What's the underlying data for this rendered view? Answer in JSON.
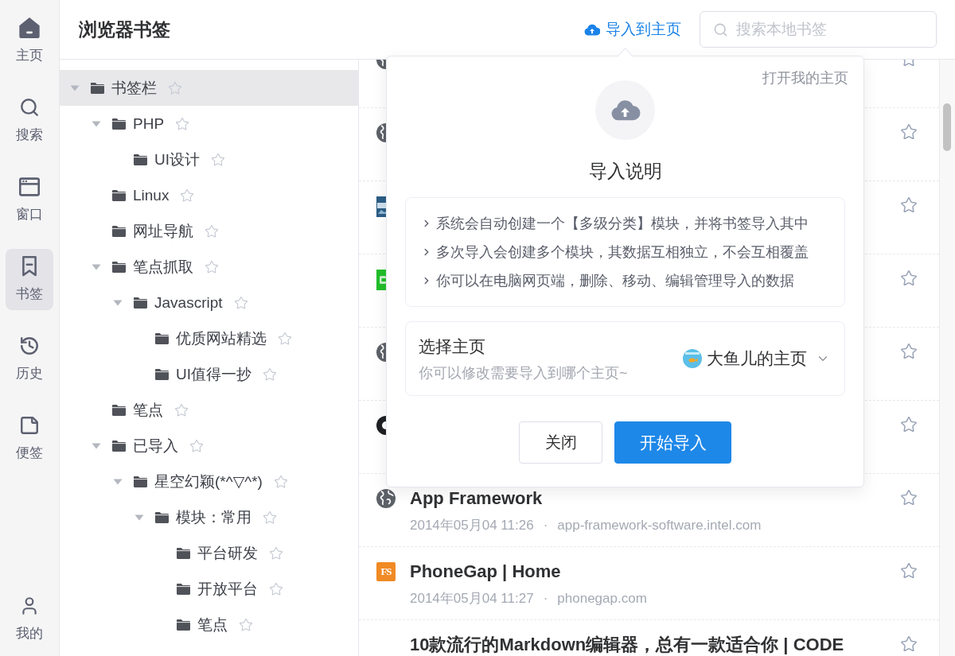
{
  "nav": {
    "items": [
      {
        "kind": "home",
        "label": "主页",
        "selected": false
      },
      {
        "kind": "search",
        "label": "搜索",
        "selected": false
      },
      {
        "kind": "window",
        "label": "窗口",
        "selected": false
      },
      {
        "kind": "bookmark",
        "label": "书签",
        "selected": true
      },
      {
        "kind": "history",
        "label": "历史",
        "selected": false
      },
      {
        "kind": "note",
        "label": "便签",
        "selected": false
      },
      {
        "kind": "profile",
        "label": "我的",
        "selected": false
      }
    ]
  },
  "header": {
    "title": "浏览器书签",
    "import_link": "导入到主页",
    "search": {
      "placeholder": "搜索本地书签"
    }
  },
  "tree": [
    {
      "label": "书签栏",
      "selected": true,
      "expanded": true,
      "children": [
        {
          "label": "PHP",
          "selected": false,
          "expanded": true,
          "children": [
            {
              "label": "UI设计",
              "selected": false
            }
          ]
        },
        {
          "label": "Linux",
          "selected": false
        },
        {
          "label": "网址导航",
          "selected": false
        },
        {
          "label": "笔点抓取",
          "selected": false,
          "expanded": true,
          "children": [
            {
              "label": "Javascript",
              "selected": false,
              "expanded": true,
              "children": [
                {
                  "label": "优质网站精选",
                  "selected": false
                },
                {
                  "label": "UI值得一抄",
                  "selected": false
                }
              ]
            }
          ]
        },
        {
          "label": "笔点",
          "selected": false
        },
        {
          "label": "已导入",
          "selected": false,
          "expanded": true,
          "children": [
            {
              "label": "星空幻颖(*^▽^*)",
              "selected": false,
              "expanded": true,
              "children": [
                {
                  "label": "模块：常用",
                  "selected": false,
                  "expanded": true,
                  "children": [
                    {
                      "label": "平台研发",
                      "selected": false
                    },
                    {
                      "label": "开放平台",
                      "selected": false
                    },
                    {
                      "label": "笔点",
                      "selected": false
                    }
                  ]
                }
              ]
            }
          ]
        }
      ]
    }
  ],
  "bookmarks": [
    {
      "kind": "globe"
    },
    {
      "kind": "globe"
    },
    {
      "kind": "photo"
    },
    {
      "kind": "app"
    },
    {
      "kind": "globe"
    },
    {
      "kind": "round"
    },
    {
      "kind": "globe",
      "title": "App Framework",
      "date": "2014年05月04 11:26",
      "separator": "·",
      "domain": "app-framework-software.intel.com"
    },
    {
      "kind": "letters",
      "logo_text": "FS",
      "title": "PhoneGap | Home",
      "date": "2014年05月04 11:27",
      "separator": "·",
      "domain": "phonegap.com"
    },
    {
      "kind": "plain",
      "title": "10款流行的Markdown编辑器，总有一款适合你 | CODE"
    }
  ],
  "import_popup": {
    "link": "打开我的主页",
    "title": "导入说明",
    "notes": [
      "系统会自动创建一个【多级分类】模块，并将书签导入其中",
      "多次导入会创建多个模块，其数据互相独立，不会互相覆盖",
      "你可以在电脑网页端，删除、移动、编辑管理导入的数据"
    ],
    "target": {
      "label": "选择主页",
      "hint": "你可以修改需要导入到哪个主页~",
      "value": "大鱼儿的主页"
    },
    "buttons": [
      {
        "kind": "close",
        "label": "关闭"
      },
      {
        "kind": "submit",
        "label": "开始导入"
      }
    ]
  }
}
